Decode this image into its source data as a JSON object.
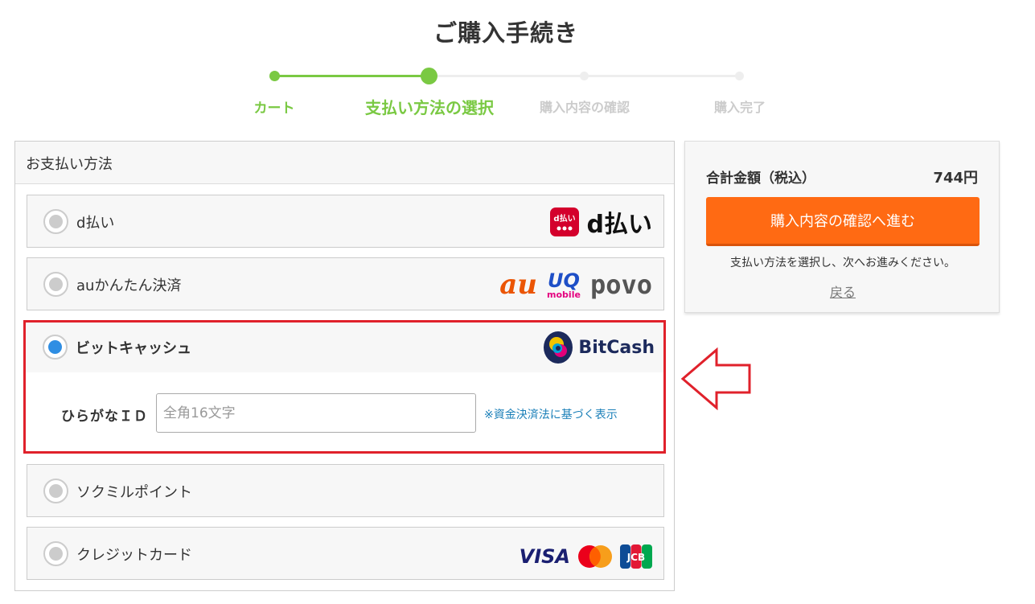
{
  "page": {
    "title": "ご購入手続き"
  },
  "stepper": {
    "steps": [
      {
        "label": "カート",
        "state": "done"
      },
      {
        "label": "支払い方法の選択",
        "state": "current"
      },
      {
        "label": "購入内容の確認",
        "state": "todo"
      },
      {
        "label": "購入完了",
        "state": "todo"
      }
    ],
    "active_color": "#7ac943",
    "inactive_color": "#cccccc"
  },
  "payment": {
    "header": "お支払い方法",
    "methods": [
      {
        "label": "d払い",
        "selected": false,
        "logos": [
          "d払い-logo"
        ]
      },
      {
        "label": "auかんたん決済",
        "selected": false,
        "logos": [
          "au-logo",
          "uq-mobile-logo",
          "povo-logo"
        ]
      },
      {
        "label": "ビットキャッシュ",
        "selected": true,
        "logos": [
          "bitcash-logo"
        ]
      },
      {
        "label": "ソクミルポイント",
        "selected": false,
        "logos": []
      },
      {
        "label": "クレジットカード",
        "selected": false,
        "logos": [
          "visa-logo",
          "mastercard-logo",
          "jcb-logo"
        ]
      }
    ],
    "bitcash": {
      "id_label": "ひらがなＩＤ",
      "id_placeholder": "全角16文字",
      "id_value": "",
      "law_link": "※資金決済法に基づく表示"
    },
    "logo_text": {
      "dpay_badge": "d払い",
      "dpay": "d払い",
      "au": "au",
      "uq": "UQ",
      "uq_sub": "mobile",
      "povo": "povo",
      "bitcash": "BitCash",
      "visa": "VISA",
      "jcb": "JCB"
    },
    "highlight_color": "#e0212b",
    "selected_radio_color": "#2f8ee3"
  },
  "summary": {
    "total_label": "合計金額（税込）",
    "total_value": "744円",
    "confirm_button": "購入内容の確認へ進む",
    "note": "支払い方法を選択し、次へお進みください。",
    "back_link": "戻る",
    "button_color": "#ff6a13"
  }
}
